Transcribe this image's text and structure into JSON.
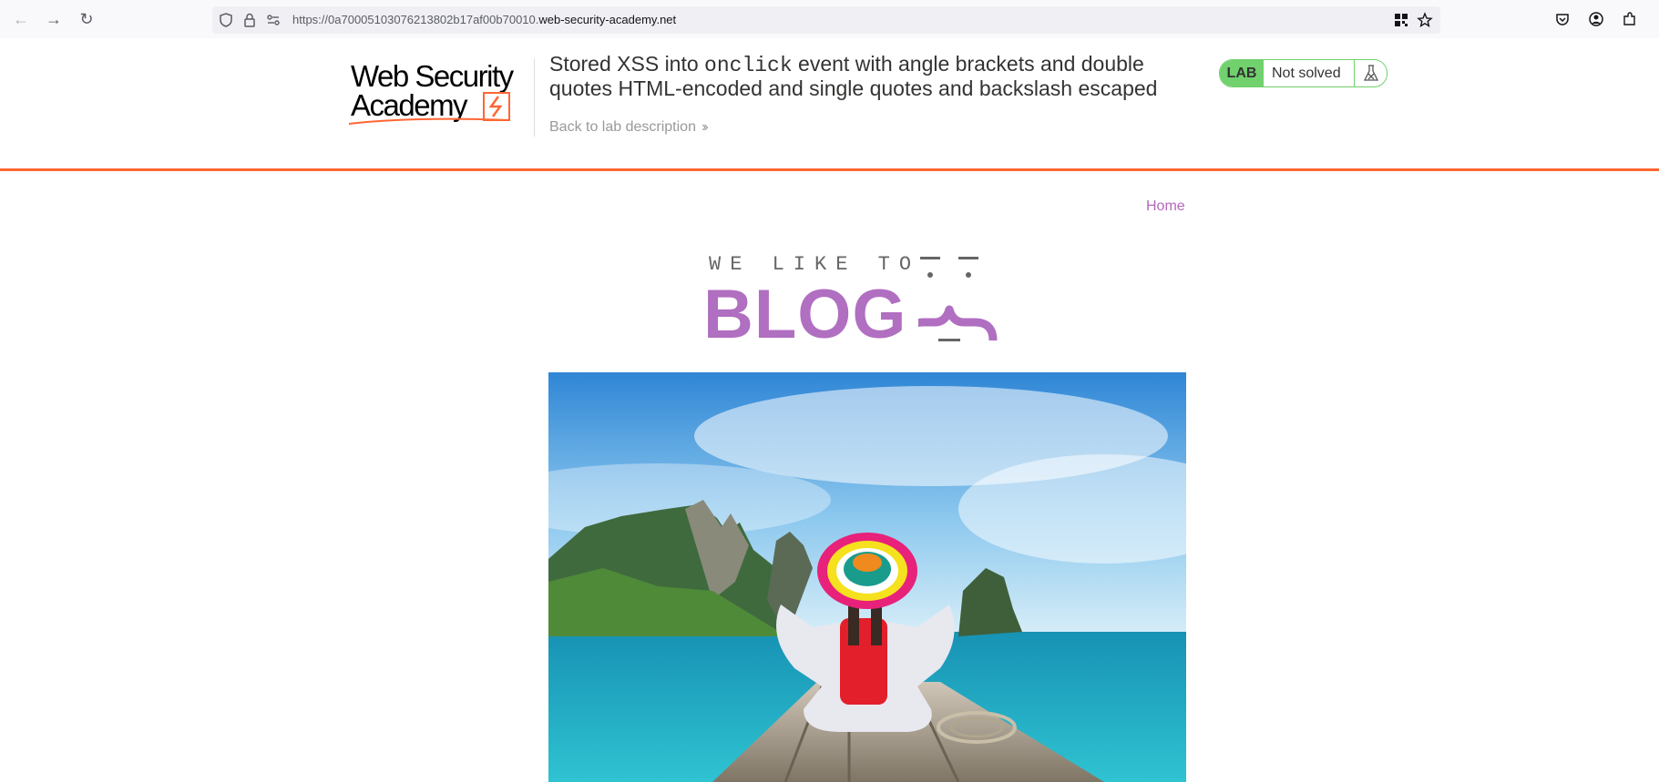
{
  "browser": {
    "url_prefix": "https://0a70005103076213802b17af00b70010.",
    "url_host": "web-security-academy.net"
  },
  "lab": {
    "logo_line1": "Web Security",
    "logo_line2": "Academy",
    "title_part1": "Stored XSS into ",
    "title_code": "onclick",
    "title_part2": " event with angle brackets and double quotes HTML-encoded and single quotes and backslash escaped",
    "back_link": "Back to lab description",
    "badge": "LAB",
    "status": "Not solved"
  },
  "blog": {
    "nav_home": "Home",
    "logo_top": "WE LIKE TO",
    "logo_main": "BLOG"
  },
  "colors": {
    "accent_orange": "#ff6633",
    "lab_green": "#70d16d",
    "blog_purple": "#b06fc0"
  }
}
